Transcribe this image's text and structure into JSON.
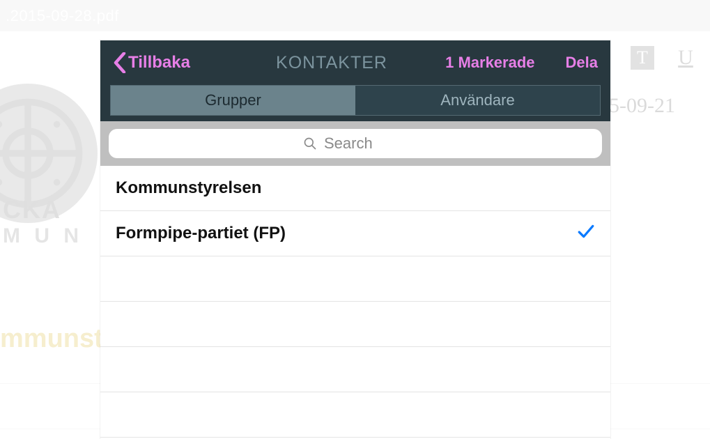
{
  "background": {
    "filename": ".2015-09-28.pdf",
    "date_text": "5-09-21",
    "emblem_l1": "CKA",
    "emblem_l2": "M U N",
    "yellow_text": "mmunsty"
  },
  "toolbar": {
    "t_icon": "T",
    "u_icon": "U"
  },
  "modal": {
    "back_label": "Tillbaka",
    "title": "KONTAKTER",
    "selected_label": "1 Markerade",
    "share_label": "Dela",
    "tabs": {
      "groups": "Grupper",
      "users": "Användare",
      "active": "groups"
    },
    "search_placeholder": "Search",
    "rows": [
      {
        "label": "Kommunstyrelsen",
        "checked": false
      },
      {
        "label": "Formpipe-partiet (FP)",
        "checked": true
      }
    ]
  }
}
